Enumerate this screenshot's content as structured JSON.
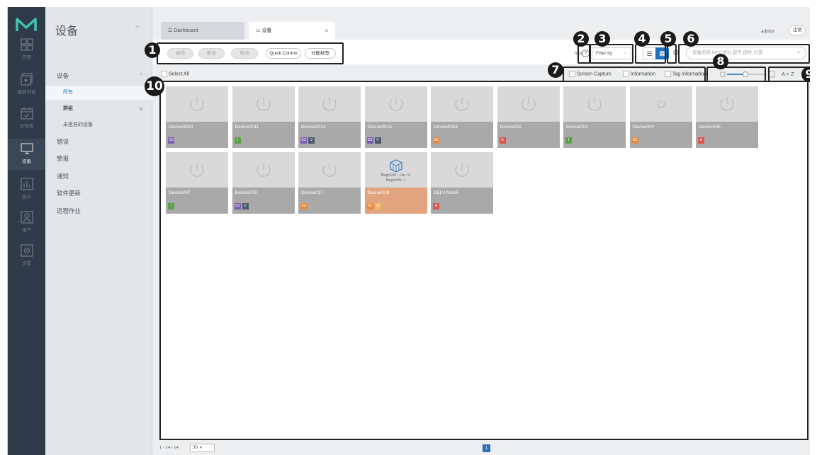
{
  "rail": {
    "items": [
      {
        "label": "内容",
        "icon": "content-grid-icon"
      },
      {
        "label": "播放列表",
        "icon": "playlist-icon"
      },
      {
        "label": "日程表",
        "icon": "schedule-icon"
      },
      {
        "label": "设备",
        "icon": "device-monitor-icon",
        "active": true
      },
      {
        "label": "统计",
        "icon": "statistics-icon"
      },
      {
        "label": "用户",
        "icon": "user-icon"
      },
      {
        "label": "设置",
        "icon": "settings-icon"
      }
    ]
  },
  "sidebar": {
    "title": "设备",
    "back": "←",
    "items": [
      {
        "label": "设备",
        "chev": "^"
      },
      {
        "label": "所有"
      },
      {
        "label": "群组",
        "chev": "v"
      },
      {
        "label": "未批准的设备"
      },
      {
        "label": "错误"
      },
      {
        "label": "警报"
      },
      {
        "label": "通知"
      },
      {
        "label": "软件更新"
      },
      {
        "label": "远程作业"
      }
    ]
  },
  "tabs": [
    {
      "label": "Dashboard",
      "icon": "list-icon"
    },
    {
      "label": "设备",
      "icon": "monitor-icon",
      "close": "×"
    }
  ],
  "header": {
    "user": "admin",
    "logout": "注销"
  },
  "toolbar": {
    "buttons": [
      "编辑",
      "删除",
      "移动",
      "Quick Control",
      "分配标签"
    ],
    "icon_label": "Icon",
    "help": "?",
    "filter": "Filter by",
    "search_placeholder": "设备名称,MAC地址,型号,固件,位置"
  },
  "options": {
    "select_all": "Select All",
    "screen_capture": "Screen Capture",
    "information": "Information",
    "tag_information": "Tag Information",
    "sort": "A > Z"
  },
  "devices": [
    {
      "name": "Device0010",
      "badges": [
        {
          "t": "S3",
          "c": "#7a5fb0"
        }
      ]
    },
    {
      "name": "Device0011",
      "badges": [
        {
          "t": "I",
          "c": "#5aa047"
        }
      ]
    },
    {
      "name": "Device0014",
      "badges": [
        {
          "t": "S3",
          "c": "#7a5fb0"
        },
        {
          "t": "V",
          "c": "#4a5a6a"
        }
      ]
    },
    {
      "name": "Device0015",
      "badges": [
        {
          "t": "S3",
          "c": "#7a5fb0"
        },
        {
          "t": "V",
          "c": "#4a5a6a"
        }
      ]
    },
    {
      "name": "Device0016",
      "badges": [
        {
          "t": "S2",
          "c": "#e88a3c"
        }
      ]
    },
    {
      "name": "Device002",
      "badges": [
        {
          "t": "A",
          "c": "#d9534f"
        }
      ]
    },
    {
      "name": "Device003",
      "badges": [
        {
          "t": "I",
          "c": "#5aa047"
        }
      ]
    },
    {
      "name": "Device004",
      "badges": [
        {
          "t": "S2",
          "c": "#e88a3c"
        }
      ]
    },
    {
      "name": "Device005",
      "badges": [
        {
          "t": "A",
          "c": "#d9534f"
        }
      ]
    },
    {
      "name": "Device007",
      "badges": [
        {
          "t": "I",
          "c": "#5aa047"
        }
      ]
    },
    {
      "name": "Device009",
      "badges": [
        {
          "t": "S3",
          "c": "#7a5fb0"
        },
        {
          "t": "V",
          "c": "#4a5a6a"
        }
      ]
    },
    {
      "name": "Device017",
      "badges": [
        {
          "t": "S2",
          "c": "#e88a3c"
        }
      ]
    },
    {
      "name": "Device018",
      "caption": [
        "MagicInfo - Lite / S",
        "MagicInfo - I"
      ],
      "highlight": true,
      "badges": [
        {
          "t": "S2",
          "c": "#e88a3c"
        },
        {
          "t": "S",
          "c": "#f0b860"
        }
      ]
    },
    {
      "name": "SELV-Note5",
      "badges": [
        {
          "t": "A",
          "c": "#d9534f"
        }
      ]
    }
  ],
  "pager": {
    "range": "1 - 14 / 14",
    "page_size": "30",
    "current": "1"
  },
  "callouts": [
    "1",
    "2",
    "3",
    "4",
    "5",
    "6",
    "7",
    "8",
    "9",
    "10"
  ]
}
